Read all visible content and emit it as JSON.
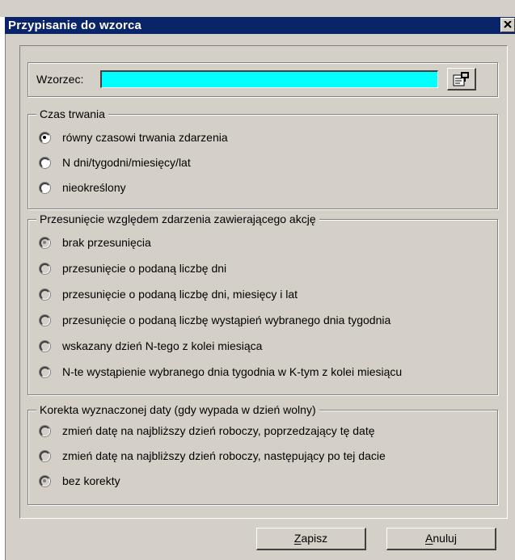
{
  "window": {
    "title": "Przypisanie do wzorca"
  },
  "wzorzec": {
    "label": "Wzorzec:",
    "value": ""
  },
  "czas": {
    "legend": "Czas trwania",
    "options": [
      {
        "label": "równy czasowi trwania zdarzenia",
        "selected": true,
        "enabled": true
      },
      {
        "label": "N dni/tygodni/miesięcy/lat",
        "selected": false,
        "enabled": true
      },
      {
        "label": "nieokreślony",
        "selected": false,
        "enabled": true
      }
    ]
  },
  "przesuniecie": {
    "legend": "Przesunięcie względem zdarzenia zawierającego akcję",
    "options": [
      {
        "label": "brak przesunięcia",
        "selected": true,
        "enabled": false
      },
      {
        "label": "przesunięcie o podaną liczbę dni",
        "selected": false,
        "enabled": false
      },
      {
        "label": "przesunięcie o podaną liczbę dni, miesięcy i lat",
        "selected": false,
        "enabled": false
      },
      {
        "label": "przesunięcie o podaną liczbę wystąpień wybranego dnia tygodnia",
        "selected": false,
        "enabled": false
      },
      {
        "label": "wskazany dzień N-tego z kolei miesiąca",
        "selected": false,
        "enabled": false
      },
      {
        "label": "N-te wystąpienie wybranego dnia tygodnia w K-tym z kolei miesiącu",
        "selected": false,
        "enabled": false
      }
    ]
  },
  "korekta": {
    "legend": "Korekta wyznaczonej daty (gdy wypada w dzień wolny)",
    "options": [
      {
        "label": "zmień datę na najbliższy dzień roboczy, poprzedzający tę datę",
        "selected": false,
        "enabled": false
      },
      {
        "label": "zmień datę na najbliższy dzień roboczy, następujący po tej dacie",
        "selected": false,
        "enabled": false
      },
      {
        "label": "bez korekty",
        "selected": true,
        "enabled": false
      }
    ]
  },
  "buttons": {
    "save": {
      "accel": "Z",
      "rest": "apisz"
    },
    "cancel": {
      "accel": "A",
      "rest": "nuluj"
    }
  },
  "colors": {
    "titlebar": "#0a246a",
    "face": "#d4d0c8",
    "input": "#00ffff"
  }
}
